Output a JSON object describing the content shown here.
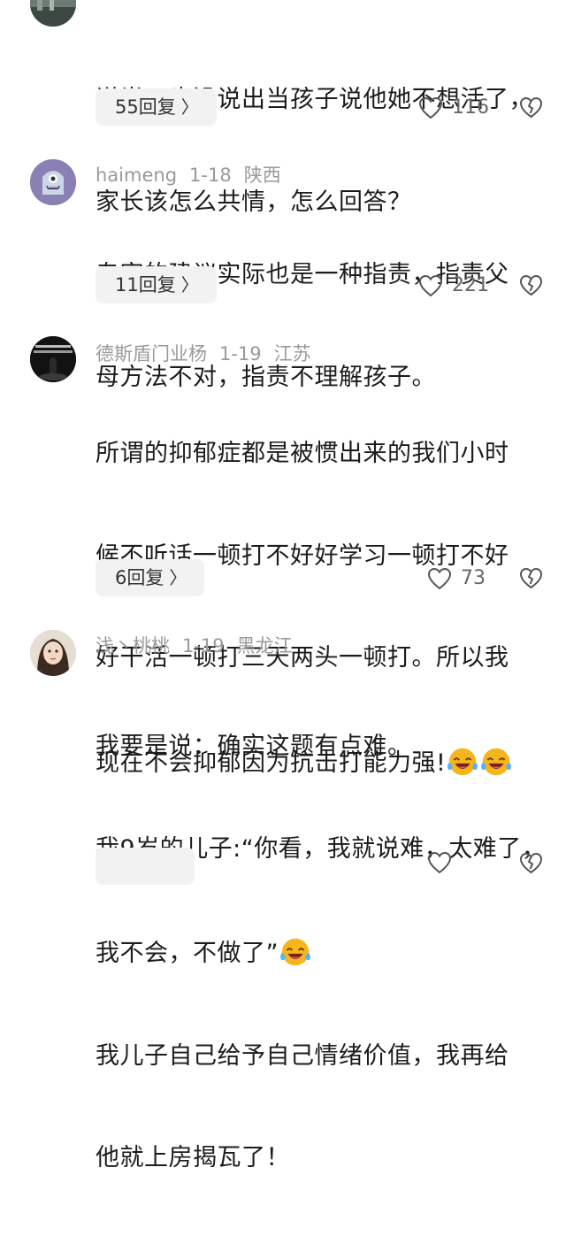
{
  "comments": [
    {
      "author": "",
      "date": "",
      "location": "",
      "lines": [
        "说半天也没说出当孩子说他她不想活了，",
        "家长该怎么共情，怎么回答？"
      ],
      "reply_label": "55回复",
      "likes": "116"
    },
    {
      "author": "haimeng",
      "date": "1-18",
      "location": "陕西",
      "lines": [
        "专家的建议实际也是一种指责，指责父",
        "母方法不对，指责不理解孩子。"
      ],
      "reply_label": "11回复",
      "likes": "221"
    },
    {
      "author": "德斯盾门业杨",
      "date": "1-19",
      "location": "江苏",
      "lines": [
        "所谓的抑郁症都是被惯出来的我们小时",
        "候不听话一顿打不好好学习一顿打不好",
        "好干活一顿打三天两头一顿打。所以我",
        "现在不会抑郁因为抗击打能力强!"
      ],
      "reply_label": "6回复",
      "likes": "73"
    },
    {
      "author": "浅丶桃桃",
      "date": "1-19",
      "location": "黑龙江",
      "lines": [
        "我要是说：确实这题有点难。",
        "我9岁的儿子:“你看，我就说难，太难了，",
        "我不会，不做了”",
        "我儿子自己给予自己情绪价值，我再给",
        "他就上房揭瓦了！"
      ],
      "reply_label": "",
      "likes": ""
    }
  ],
  "icons": {
    "reply_chevron": "chevron-right-icon",
    "like": "heart-outline-icon",
    "dislike": "broken-heart-icon",
    "emoji": "laughing-crying-emoji-icon"
  },
  "colors": {
    "meta_gray": "#9a9a9a",
    "reply_bg": "#f2f2f2",
    "emoji_yellow": "#f5b51c"
  }
}
